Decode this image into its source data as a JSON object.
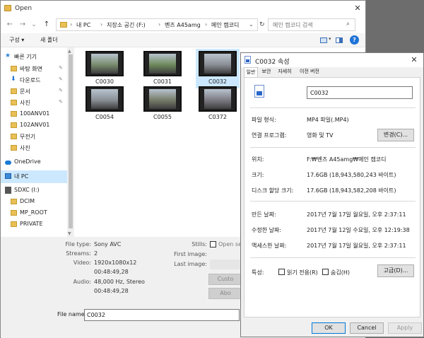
{
  "open": {
    "title": "Open",
    "close": "✕",
    "nav": {
      "back": "←",
      "forward": "→",
      "dropdown": "⌄",
      "up": "↑"
    },
    "address": [
      "내 PC",
      "지장소 공긴 (F:)",
      "벤즈 A45amg",
      "메인 캠코디"
    ],
    "address_sep": "›",
    "search_placeholder": "메인 캠코디 검색",
    "toolbar": {
      "organize": "구성 ▾",
      "new_folder": "새 폴더",
      "help": "?"
    },
    "sidebar": [
      {
        "label": "빠른 기기",
        "type": "star"
      },
      {
        "label": "바탕 화면",
        "type": "folder",
        "pinned": true
      },
      {
        "label": "다운로드",
        "type": "download",
        "pinned": true
      },
      {
        "label": "문서",
        "type": "folder",
        "pinned": true
      },
      {
        "label": "사진",
        "type": "folder",
        "pinned": true
      },
      {
        "label": "100ANV01",
        "type": "folder"
      },
      {
        "label": "102ANV01",
        "type": "folder"
      },
      {
        "label": "무전기",
        "type": "folder"
      },
      {
        "label": "사진",
        "type": "folder"
      },
      {
        "label": "OneDrive",
        "type": "cloud"
      },
      {
        "label": "내 PC",
        "type": "pc",
        "selected": true
      },
      {
        "label": "SDXC (I:)",
        "type": "sd"
      },
      {
        "label": "DCIM",
        "type": "folder"
      },
      {
        "label": "MP_ROOT",
        "type": "folder"
      },
      {
        "label": "PRIVATE",
        "type": "folder"
      }
    ],
    "pin_glyph": "📌",
    "files": [
      {
        "name": "C0030",
        "color": "#7a8c6e"
      },
      {
        "name": "C0031",
        "color": "#6f8a5c"
      },
      {
        "name": "C0032",
        "color": "#8b8f96",
        "selected": true
      },
      {
        "name": "C0054",
        "color": "#8a9096"
      },
      {
        "name": "C0055",
        "color": "#777d6a"
      },
      {
        "name": "C0372",
        "color": "#7d7b84"
      }
    ],
    "info": {
      "file_type_k": "File type:",
      "file_type_v": "Sony AVC",
      "streams_k": "Streams:",
      "streams_v": "2",
      "video_k": "Video:",
      "video_v1": "1920x1080x12",
      "video_v2": "00:48:49,28",
      "audio_k": "Audio:",
      "audio_v1": "48,000 Hz, Stereo",
      "audio_v2": "00:48:49,28",
      "stills_k": "Stills:",
      "stills_v": "Open seq",
      "first_image_k": "First image:",
      "last_image_k": "Last image:",
      "btn_cust": "Custo",
      "btn_abo": "Abo"
    },
    "file_name_label": "File name:",
    "file_name_value": "C0032"
  },
  "props": {
    "title": "C0032 속성",
    "close": "✕",
    "tabs": [
      "일반",
      "보안",
      "자세히",
      "이전 버전"
    ],
    "name": "C0032",
    "rows1": [
      {
        "k": "파일 형식:",
        "v": "MP4 파일(.MP4)"
      },
      {
        "k": "연결 프로그램:",
        "v": "영화 및 TV"
      }
    ],
    "change_btn": "변경(C)...",
    "rows2": [
      {
        "k": "위치:",
        "v": "F:₩벤즈 A45amg₩메인 캠코디"
      },
      {
        "k": "크기:",
        "v": "17.6GB (18,943,580,243 바이트)"
      },
      {
        "k": "디스크 할당 크기:",
        "v": "17.6GB (18,943,582,208 바이트)"
      }
    ],
    "rows3": [
      {
        "k": "만든 날짜:",
        "v": "2017년 7월 17일 월요일, 오후 2:37:11"
      },
      {
        "k": "수정한 날짜:",
        "v": "2017년 7월 12일 수요일, 오후 12:19:38"
      },
      {
        "k": "액세스한 날짜:",
        "v": "2017년 7월 17일 월요일, 오후 2:37:11"
      }
    ],
    "attr_label": "특성:",
    "readonly": "읽기 전용(R)",
    "hidden": "숨김(H)",
    "advanced_btn": "고급(D)...",
    "ok": "OK",
    "cancel": "Cancel",
    "apply": "Apply"
  }
}
